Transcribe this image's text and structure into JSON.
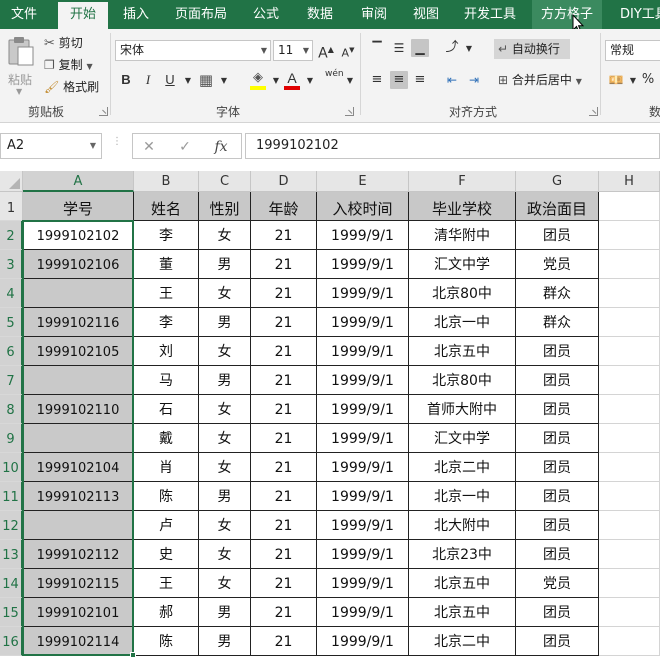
{
  "ribbon_tabs": [
    {
      "label": "文件"
    },
    {
      "label": "开始"
    },
    {
      "label": "插入"
    },
    {
      "label": "页面布局"
    },
    {
      "label": "公式"
    },
    {
      "label": "数据"
    },
    {
      "label": "审阅"
    },
    {
      "label": "视图"
    },
    {
      "label": "开发工具"
    },
    {
      "label": "方方格子"
    },
    {
      "label": "DIY工具"
    }
  ],
  "active_tab": "开始",
  "clipboard": {
    "paste": "粘贴",
    "cut": "剪切",
    "copy": "复制",
    "format_painter": "格式刷",
    "group_label": "剪贴板"
  },
  "font": {
    "name": "宋体",
    "size": "11",
    "grow": "A",
    "shrink": "A",
    "bold": "B",
    "italic": "I",
    "underline": "U",
    "font_color_glyph": "A",
    "phonetic": "wén",
    "group_label": "字体"
  },
  "alignment": {
    "wrap_text": "自动换行",
    "merge_center": "合并后居中",
    "group_label": "对齐方式"
  },
  "number": {
    "format": "常规",
    "percent": "%",
    "group_label": "数"
  },
  "formula_bar": {
    "name_box": "A2",
    "fx": "fx",
    "content": "1999102102"
  },
  "column_headers": [
    "A",
    "B",
    "C",
    "D",
    "E",
    "F",
    "G",
    "H"
  ],
  "table_headers": [
    "学号",
    "姓名",
    "性别",
    "年龄",
    "入校时间",
    "毕业学校",
    "政治面目"
  ],
  "rows": [
    {
      "row": "1"
    },
    {
      "row": "2",
      "cells": [
        "1999102102",
        "李",
        "女",
        "21",
        "1999/9/1",
        "清华附中",
        "团员"
      ]
    },
    {
      "row": "3",
      "cells": [
        "1999102106",
        "董",
        "男",
        "21",
        "1999/9/1",
        "汇文中学",
        "党员"
      ]
    },
    {
      "row": "4",
      "cells": [
        "",
        "王",
        "女",
        "21",
        "1999/9/1",
        "北京80中",
        "群众"
      ]
    },
    {
      "row": "5",
      "cells": [
        "1999102116",
        "李",
        "男",
        "21",
        "1999/9/1",
        "北京一中",
        "群众"
      ]
    },
    {
      "row": "6",
      "cells": [
        "1999102105",
        "刘",
        "女",
        "21",
        "1999/9/1",
        "北京五中",
        "团员"
      ]
    },
    {
      "row": "7",
      "cells": [
        "",
        "马",
        "男",
        "21",
        "1999/9/1",
        "北京80中",
        "团员"
      ]
    },
    {
      "row": "8",
      "cells": [
        "1999102110",
        "石",
        "女",
        "21",
        "1999/9/1",
        "首师大附中",
        "团员"
      ]
    },
    {
      "row": "9",
      "cells": [
        "",
        "戴",
        "女",
        "21",
        "1999/9/1",
        "汇文中学",
        "团员"
      ]
    },
    {
      "row": "10",
      "cells": [
        "1999102104",
        "肖",
        "女",
        "21",
        "1999/9/1",
        "北京二中",
        "团员"
      ]
    },
    {
      "row": "11",
      "cells": [
        "1999102113",
        "陈",
        "男",
        "21",
        "1999/9/1",
        "北京一中",
        "团员"
      ]
    },
    {
      "row": "12",
      "cells": [
        "",
        "卢",
        "女",
        "21",
        "1999/9/1",
        "北大附中",
        "团员"
      ]
    },
    {
      "row": "13",
      "cells": [
        "1999102112",
        "史",
        "女",
        "21",
        "1999/9/1",
        "北京23中",
        "团员"
      ]
    },
    {
      "row": "14",
      "cells": [
        "1999102115",
        "王",
        "女",
        "21",
        "1999/9/1",
        "北京五中",
        "党员"
      ]
    },
    {
      "row": "15",
      "cells": [
        "1999102101",
        "郝",
        "男",
        "21",
        "1999/9/1",
        "北京五中",
        "团员"
      ]
    },
    {
      "row": "16",
      "cells": [
        "1999102114",
        "陈",
        "男",
        "21",
        "1999/9/1",
        "北京二中",
        "团员"
      ]
    }
  ],
  "colors": {
    "excel_green": "#217346",
    "ribbon_bg": "#f3f3f3",
    "selection_fill": "#c9c9c9",
    "header_fill": "#c8c8c8"
  }
}
